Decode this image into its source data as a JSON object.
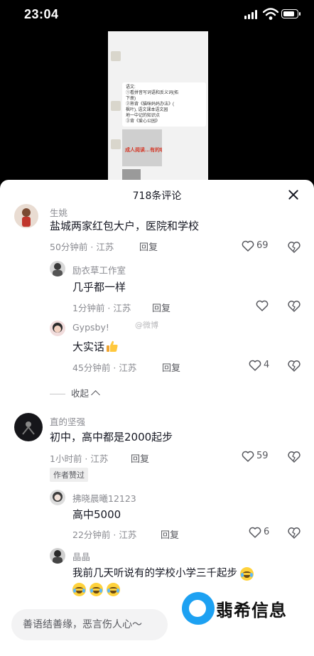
{
  "status_bar": {
    "time": "23:04"
  },
  "video_preview": {
    "bubble_lines": [
      "语文:",
      "①看拼音写词语和反义词(拓",
      "下册)",
      "②熟背《猫咪妈妈办法》(",
      "枫叶), 语文课本语文园",
      "地一中记的知识点",
      "③背《爱心公园》"
    ],
    "screenshot_caption": "成人阅读…有的呢让之心呢?"
  },
  "sheet": {
    "title": "718条评论"
  },
  "comments": [
    {
      "user": "生姚",
      "text": "盐城两家红包大户，医院和学校",
      "time": "50分钟前 · 江苏",
      "reply": "回复",
      "likes": "69"
    },
    {
      "user": "励衣草工作室",
      "text": "几乎都一样",
      "time": "1分钟前 · 江苏",
      "reply": "回复",
      "likes": ""
    },
    {
      "user": "Gypsby!",
      "text": "大实话",
      "time": "45分钟前 · 江苏",
      "reply": "回复",
      "likes": "4"
    },
    {
      "user": "直的坚强",
      "text": "初中，高中都是2000起步",
      "time": "1小时前 · 江苏",
      "reply": "回复",
      "likes": "59",
      "tag": "作者赞过"
    },
    {
      "user": "拂晓晨曦12123",
      "text": "高中5000",
      "time": "22分钟前 · 江苏",
      "reply": "回复",
      "likes": "6"
    },
    {
      "user": "晶晶",
      "text": "我前几天听说有的学校小学三千起步"
    }
  ],
  "collapse_label": "收起",
  "weibo_watermark": "@微博",
  "input": {
    "placeholder": "善语结善缘，恶言伤人心～"
  },
  "watermark_brand": "翡希信息",
  "colors": {
    "sheet_bg": "#ffffff",
    "text_primary": "#161823",
    "text_secondary": "#8a8b91",
    "brand_blue": "#1da1f2"
  }
}
